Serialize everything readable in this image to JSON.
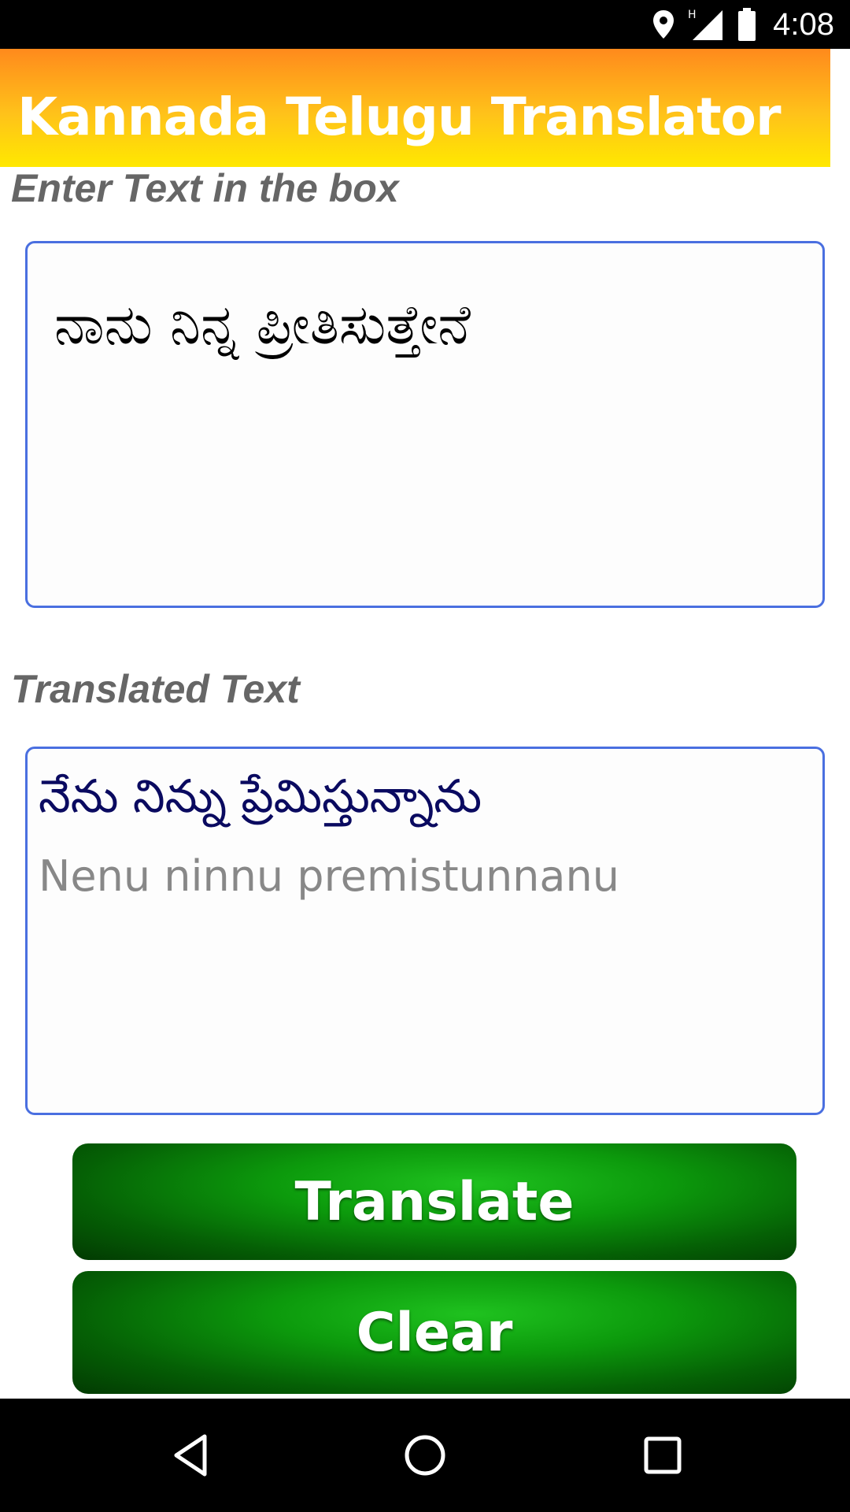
{
  "status_bar": {
    "time": "4:08",
    "network_label": "H",
    "icons": [
      "location-icon",
      "signal-icon",
      "battery-icon"
    ]
  },
  "app": {
    "title": "Kannada Telugu Translator"
  },
  "input_section": {
    "label": "Enter Text in the box",
    "value": "ನಾನು ನಿನ್ನ ಪ್ರೀತಿಸುತ್ತೇನೆ"
  },
  "output_section": {
    "label": "Translated Text",
    "telugu": "నేను నిన్ను ప్రేమిస్తున్నాను",
    "transliteration": "Nenu ninnu premistunnanu"
  },
  "buttons": {
    "translate": "Translate",
    "clear": "Clear"
  },
  "nav_bar": {
    "icons": [
      "back-icon",
      "home-icon",
      "recent-apps-icon"
    ]
  },
  "colors": {
    "title_gradient_top": "#ff8a1c",
    "title_gradient_bottom": "#ffe800",
    "box_border": "#4a6fe0",
    "button_green": "#0c9a0c"
  }
}
